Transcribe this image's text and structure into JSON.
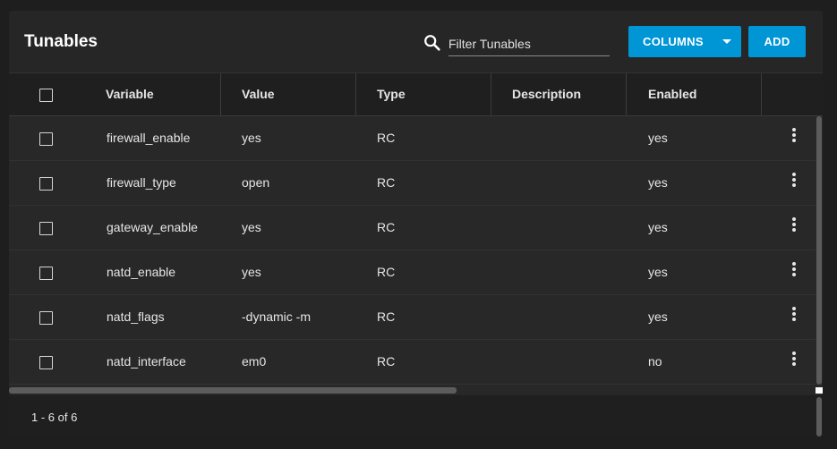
{
  "header": {
    "title": "Tunables",
    "search": {
      "placeholder": "Filter Tunables",
      "value": ""
    },
    "columns_button": "COLUMNS",
    "add_button": "ADD"
  },
  "table": {
    "columns": [
      "Variable",
      "Value",
      "Type",
      "Description",
      "Enabled"
    ],
    "rows": [
      {
        "variable": "firewall_enable",
        "value": "yes",
        "type": "RC",
        "description": "",
        "enabled": "yes"
      },
      {
        "variable": "firewall_type",
        "value": "open",
        "type": "RC",
        "description": "",
        "enabled": "yes"
      },
      {
        "variable": "gateway_enable",
        "value": "yes",
        "type": "RC",
        "description": "",
        "enabled": "yes"
      },
      {
        "variable": "natd_enable",
        "value": "yes",
        "type": "RC",
        "description": "",
        "enabled": "yes"
      },
      {
        "variable": "natd_flags",
        "value": "-dynamic -m",
        "type": "RC",
        "description": "",
        "enabled": "yes"
      },
      {
        "variable": "natd_interface",
        "value": "em0",
        "type": "RC",
        "description": "",
        "enabled": "no"
      }
    ]
  },
  "footer": {
    "paginator": "1 - 6 of 6"
  },
  "colors": {
    "accent": "#0095d5",
    "background": "#1e1e1e",
    "card": "#262626"
  },
  "icons": {
    "search": "search-icon",
    "row_menu": "more-vert-icon",
    "dropdown": "caret-down-icon"
  }
}
